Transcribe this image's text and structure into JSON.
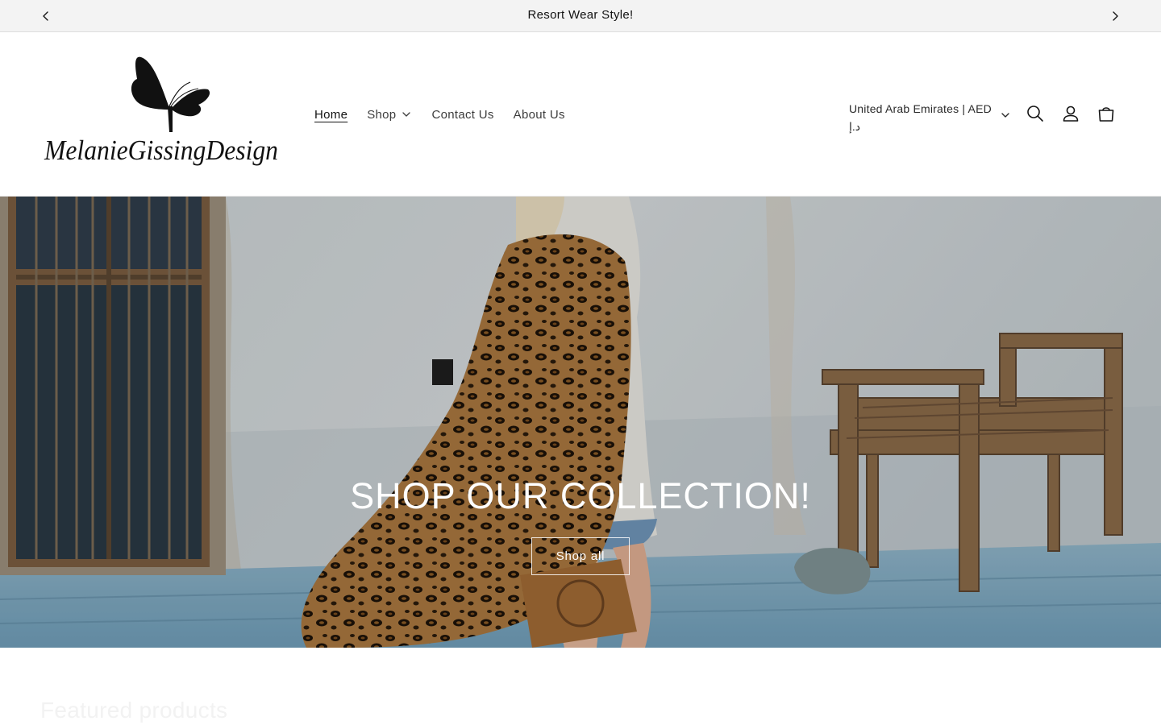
{
  "announcement": {
    "text": "Resort Wear Style!",
    "prev_icon": "chevron-left-icon",
    "next_icon": "chevron-right-icon"
  },
  "header": {
    "logo_text": "MelanieGissingDesign",
    "nav": [
      {
        "label": "Home",
        "active": true
      },
      {
        "label": "Shop",
        "has_dropdown": true
      },
      {
        "label": "Contact Us"
      },
      {
        "label": "About Us"
      }
    ],
    "localization": {
      "country": "United Arab Emirates | AED",
      "currency_symbol": "د.إ"
    },
    "icons": [
      "search-icon",
      "account-icon",
      "cart-icon"
    ]
  },
  "hero": {
    "heading": "SHOP OUR COLLECTION!",
    "button_label": "Shop all"
  },
  "featured": {
    "title": "Featured products"
  },
  "colors": {
    "announcement_bg": "#f3f3f3",
    "text": "#121212",
    "hero_text": "#ffffff"
  }
}
